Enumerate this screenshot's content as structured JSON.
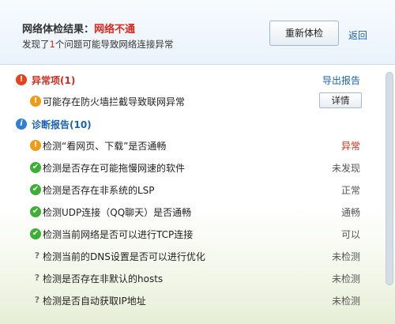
{
  "header": {
    "result_label": "网络体检结果：",
    "result_status": "网络不通",
    "summary_prefix": "发现了",
    "summary_count": "1",
    "summary_suffix": "个问题可能导致网络连接异常",
    "recheck_button": "重新体检",
    "back_link": "返回"
  },
  "abnormal_section": {
    "title": "异常项(1)",
    "export_link": "导出报告",
    "items": [
      {
        "label": "可能存在防火墙拦截导致联网异常",
        "button": "详情",
        "icon": "warning-icon"
      }
    ]
  },
  "report_section": {
    "title": "诊断报告(10)",
    "items": [
      {
        "label": "检测“看网页、下载”是否通畅",
        "status": "异常",
        "icon": "warning-icon"
      },
      {
        "label": "检测是否存在可能拖慢网速的软件",
        "status": "未发现",
        "icon": "check-icon"
      },
      {
        "label": "检测是否存在非系统的LSP",
        "status": "正常",
        "icon": "check-icon"
      },
      {
        "label": "检测UDP连接（QQ聊天）是否通畅",
        "status": "通畅",
        "icon": "check-icon"
      },
      {
        "label": "检测当前网络是否可以进行TCP连接",
        "status": "可以",
        "icon": "check-icon"
      },
      {
        "label": "检测当前的DNS设置是否可以进行优化",
        "status": "未检测",
        "icon": "question-icon"
      },
      {
        "label": "检测是否存在非默认的hosts",
        "status": "未检测",
        "icon": "question-icon"
      },
      {
        "label": "检测是否自动获取IP地址",
        "status": "未检测",
        "icon": "question-icon"
      }
    ]
  },
  "colors": {
    "alert_red": "#e0261a",
    "link_blue": "#1a62b8",
    "ok_green": "#3cb034",
    "warn_orange": "#f29a16"
  }
}
